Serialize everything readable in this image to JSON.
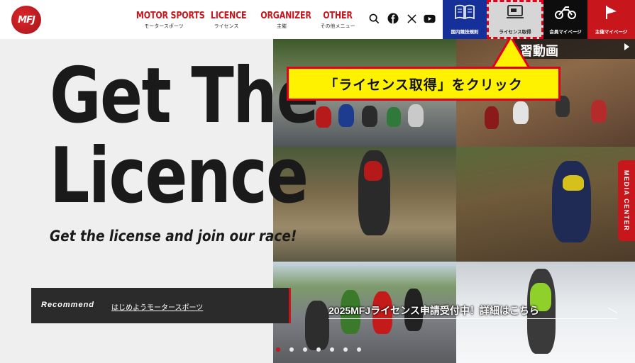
{
  "header": {
    "logo": "MFJ",
    "nav": [
      {
        "main": "MOTOR SPORTS",
        "sub": "モータースポーツ"
      },
      {
        "main": "LICENCE",
        "sub": "ライセンス"
      },
      {
        "main": "ORGANIZER",
        "sub": "主催"
      },
      {
        "main": "OTHER",
        "sub": "その他メニュー"
      }
    ],
    "icons": [
      "search-icon",
      "facebook-icon",
      "x-icon",
      "youtube-icon"
    ],
    "tiles": [
      {
        "label": "国内競技規則",
        "icon": "book-icon",
        "color": "#16309a"
      },
      {
        "label": "ライセンス取得",
        "icon": "license-card-icon",
        "color": "#d6d6d6"
      },
      {
        "label": "会員マイページ",
        "icon": "motorcycle-icon",
        "color": "#0d0d0d"
      },
      {
        "label": "主催マイページ",
        "icon": "flag-icon",
        "color": "#c8161d"
      }
    ]
  },
  "callout": {
    "text": "「ライセンス取得」をクリック"
  },
  "hero": {
    "title_line1": "Get The",
    "title_line2": "Licence",
    "subtitle": "Get the license and join our race!",
    "video_label": "習動画",
    "media_center": "MEDIA CENTER",
    "banner_text": "2025MFJライセンス申請受付中！詳細はこちら"
  },
  "recommend": {
    "label": "Recommend",
    "link": "はじめようモータースポーツ"
  },
  "slider": {
    "count": 7,
    "active_index": 0
  },
  "colors": {
    "brand_red": "#c8161d",
    "nav_blue": "#16309a",
    "callout_yellow": "#fff200"
  }
}
